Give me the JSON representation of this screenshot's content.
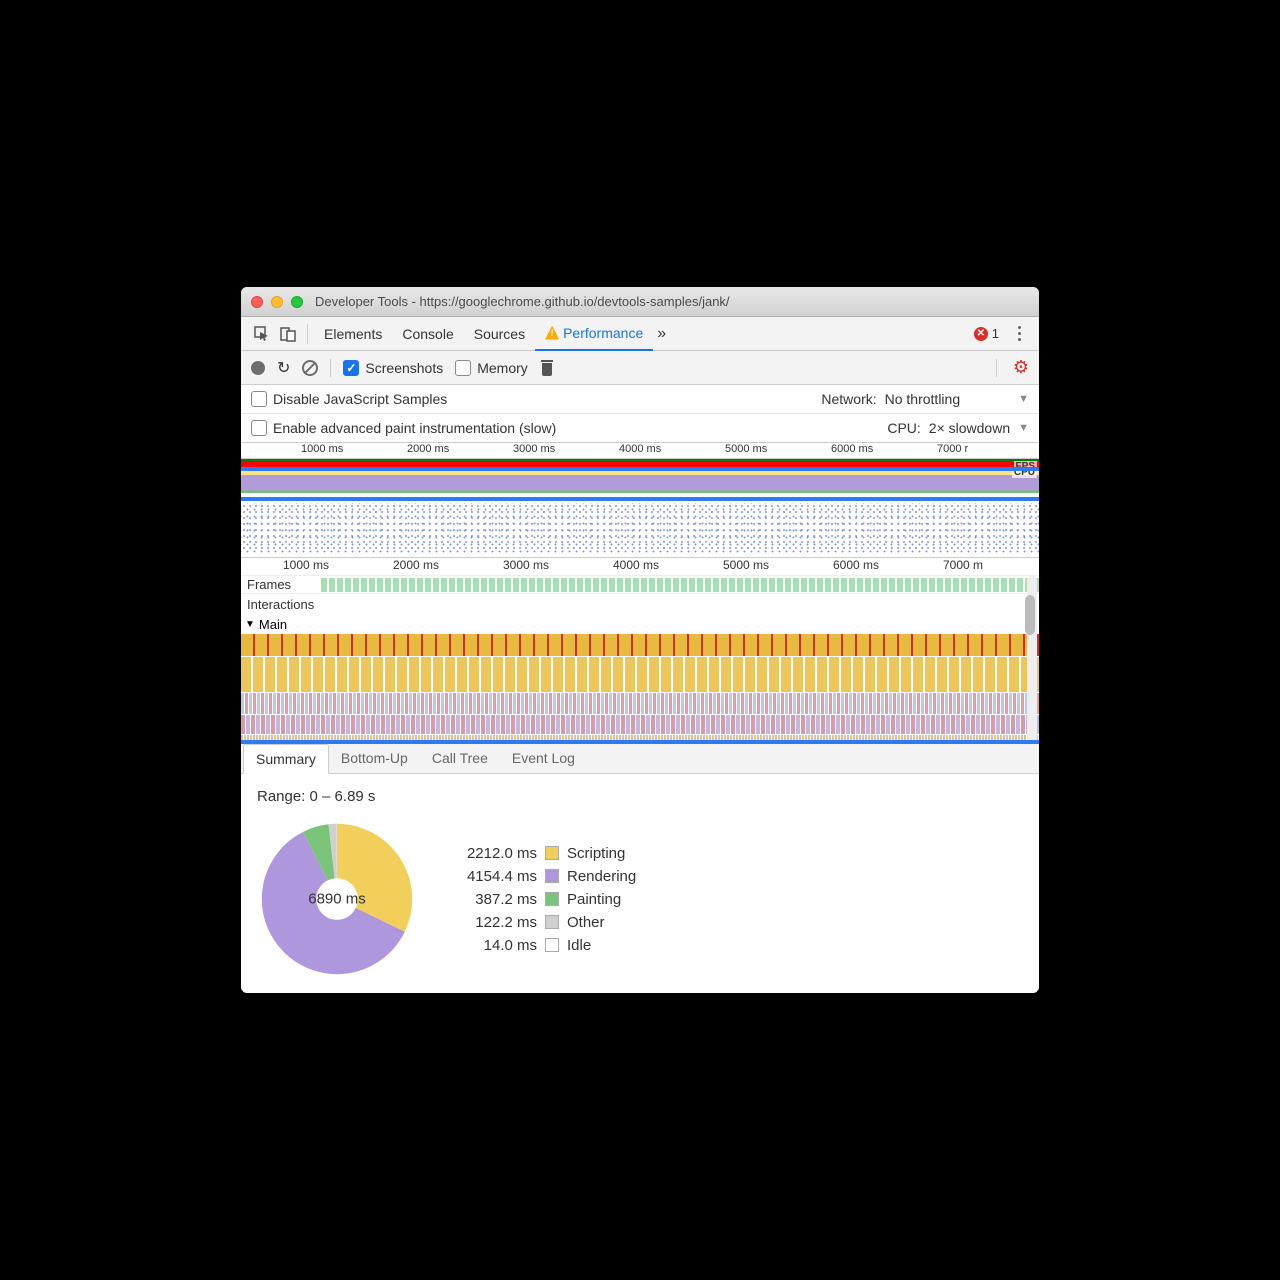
{
  "window": {
    "title": "Developer Tools - https://googlechrome.github.io/devtools-samples/jank/"
  },
  "tabs": {
    "elements": "Elements",
    "console": "Console",
    "sources": "Sources",
    "performance": "Performance",
    "more": "»",
    "errorCount": "1"
  },
  "toolbar": {
    "screenshots": "Screenshots",
    "memory": "Memory"
  },
  "settings": {
    "disableJs": "Disable JavaScript Samples",
    "advancedPaint": "Enable advanced paint instrumentation (slow)",
    "networkLabel": "Network:",
    "networkValue": "No throttling",
    "cpuLabel": "CPU:",
    "cpuValue": "2× slowdown"
  },
  "overview": {
    "ticks": [
      "1000 ms",
      "2000 ms",
      "3000 ms",
      "4000 ms",
      "5000 ms",
      "6000 ms",
      "7000 r"
    ],
    "ticksLower": [
      "1000 ms",
      "2000 ms",
      "3000 ms",
      "4000 ms",
      "5000 ms",
      "6000 ms",
      "7000 m"
    ],
    "fpsLabel": "FPS",
    "cpuLabel": "CPU"
  },
  "tracks": {
    "frames": "Frames",
    "interactions": "Interactions",
    "main": "Main"
  },
  "detailTabs": {
    "summary": "Summary",
    "bottomUp": "Bottom-Up",
    "callTree": "Call Tree",
    "eventLog": "Event Log"
  },
  "summary": {
    "range": "Range: 0 – 6.89 s",
    "total": "6890 ms",
    "items": [
      {
        "value": "2212.0 ms",
        "label": "Scripting",
        "color": "#f2ce5a"
      },
      {
        "value": "4154.4 ms",
        "label": "Rendering",
        "color": "#af97dd"
      },
      {
        "value": "387.2 ms",
        "label": "Painting",
        "color": "#7ac47a"
      },
      {
        "value": "122.2 ms",
        "label": "Other",
        "color": "#d0d0d0"
      },
      {
        "value": "14.0 ms",
        "label": "Idle",
        "color": "#ffffff"
      }
    ]
  },
  "chart_data": {
    "type": "pie",
    "title": "Summary",
    "series": [
      {
        "name": "Scripting",
        "value": 2212.0,
        "color": "#f2ce5a"
      },
      {
        "name": "Rendering",
        "value": 4154.4,
        "color": "#af97dd"
      },
      {
        "name": "Painting",
        "value": 387.2,
        "color": "#7ac47a"
      },
      {
        "name": "Other",
        "value": 122.2,
        "color": "#d0d0d0"
      },
      {
        "name": "Idle",
        "value": 14.0,
        "color": "#ffffff"
      }
    ],
    "total": 6890,
    "unit": "ms",
    "range": [
      0,
      6.89
    ]
  }
}
